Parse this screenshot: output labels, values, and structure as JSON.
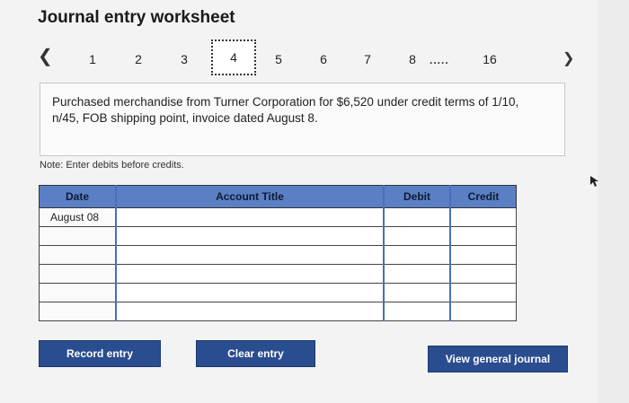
{
  "title": "Journal entry worksheet",
  "nav": {
    "prev_icon": "chevron-left-icon",
    "next_icon": "chevron-right-icon",
    "steps": [
      "1",
      "2",
      "3",
      "4",
      "5",
      "6",
      "7",
      "8",
      "16"
    ],
    "current_step": "4",
    "ellipsis": "....."
  },
  "problem": {
    "text": "Purchased merchandise from Turner Corporation for $6,520 under credit terms of 1/10, n/45, FOB shipping point, invoice dated August 8."
  },
  "note": "Note: Enter debits before credits.",
  "table": {
    "headers": {
      "date": "Date",
      "account": "Account Title",
      "debit": "Debit",
      "credit": "Credit"
    },
    "rows": [
      {
        "date": "August 08",
        "account": "",
        "debit": "",
        "credit": ""
      },
      {
        "date": "",
        "account": "",
        "debit": "",
        "credit": ""
      },
      {
        "date": "",
        "account": "",
        "debit": "",
        "credit": ""
      },
      {
        "date": "",
        "account": "",
        "debit": "",
        "credit": ""
      },
      {
        "date": "",
        "account": "",
        "debit": "",
        "credit": ""
      },
      {
        "date": "",
        "account": "",
        "debit": "",
        "credit": ""
      }
    ]
  },
  "buttons": {
    "record": "Record entry",
    "clear": "Clear entry",
    "view": "View general journal"
  },
  "colors": {
    "header_blue": "#5b7fc4",
    "button_blue": "#2a4d8f",
    "input_border_blue": "#4a6fb8"
  }
}
